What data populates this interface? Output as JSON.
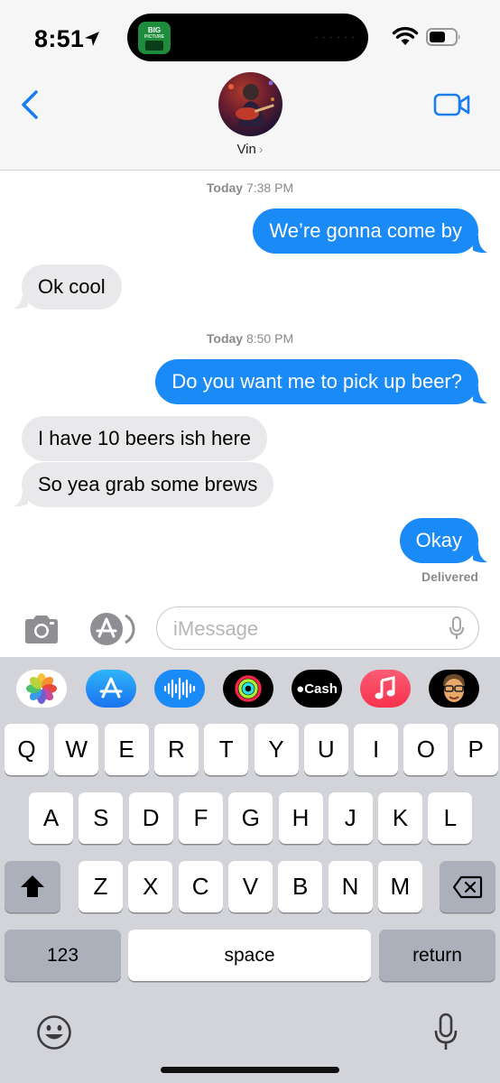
{
  "status": {
    "time": "8:51"
  },
  "island_app": {
    "line1": "BIG",
    "line2": "PICTURE"
  },
  "contact": {
    "name": "Vin",
    "chevron": "›"
  },
  "messages": [
    {
      "type": "timestamp",
      "day": "Today",
      "time": "7:38 PM"
    },
    {
      "type": "sent",
      "text": "We’re gonna come by"
    },
    {
      "type": "received",
      "text": "Ok cool"
    },
    {
      "type": "timestamp",
      "day": "Today",
      "time": "8:50 PM"
    },
    {
      "type": "sent",
      "text": "Do you want me to pick up beer?"
    },
    {
      "type": "received",
      "text": "I have 10 beers ish here"
    },
    {
      "type": "received",
      "text": "So yea grab some brews"
    },
    {
      "type": "sent",
      "text": "Okay"
    }
  ],
  "delivery_status": "Delivered",
  "input": {
    "placeholder": "iMessage"
  },
  "app_strip": [
    {
      "icon": "photos-icon"
    },
    {
      "icon": "app-store-icon"
    },
    {
      "icon": "audio-message-icon"
    },
    {
      "icon": "activity-icon"
    },
    {
      "icon": "apple-cash-icon",
      "label": "Cash"
    },
    {
      "icon": "music-icon"
    },
    {
      "icon": "memoji-icon"
    }
  ],
  "keyboard": {
    "row1": [
      "Q",
      "W",
      "E",
      "R",
      "T",
      "Y",
      "U",
      "I",
      "O",
      "P"
    ],
    "row2": [
      "A",
      "S",
      "D",
      "F",
      "G",
      "H",
      "J",
      "K",
      "L"
    ],
    "row3": [
      "Z",
      "X",
      "C",
      "V",
      "B",
      "N",
      "M"
    ],
    "numbers_label": "123",
    "space_label": "space",
    "return_label": "return"
  },
  "colors": {
    "sent_bubble": "#1a8af6",
    "received_bubble": "#e9e9eb",
    "accent": "#1a7df0",
    "keyboard_bg": "#d2d4da"
  }
}
